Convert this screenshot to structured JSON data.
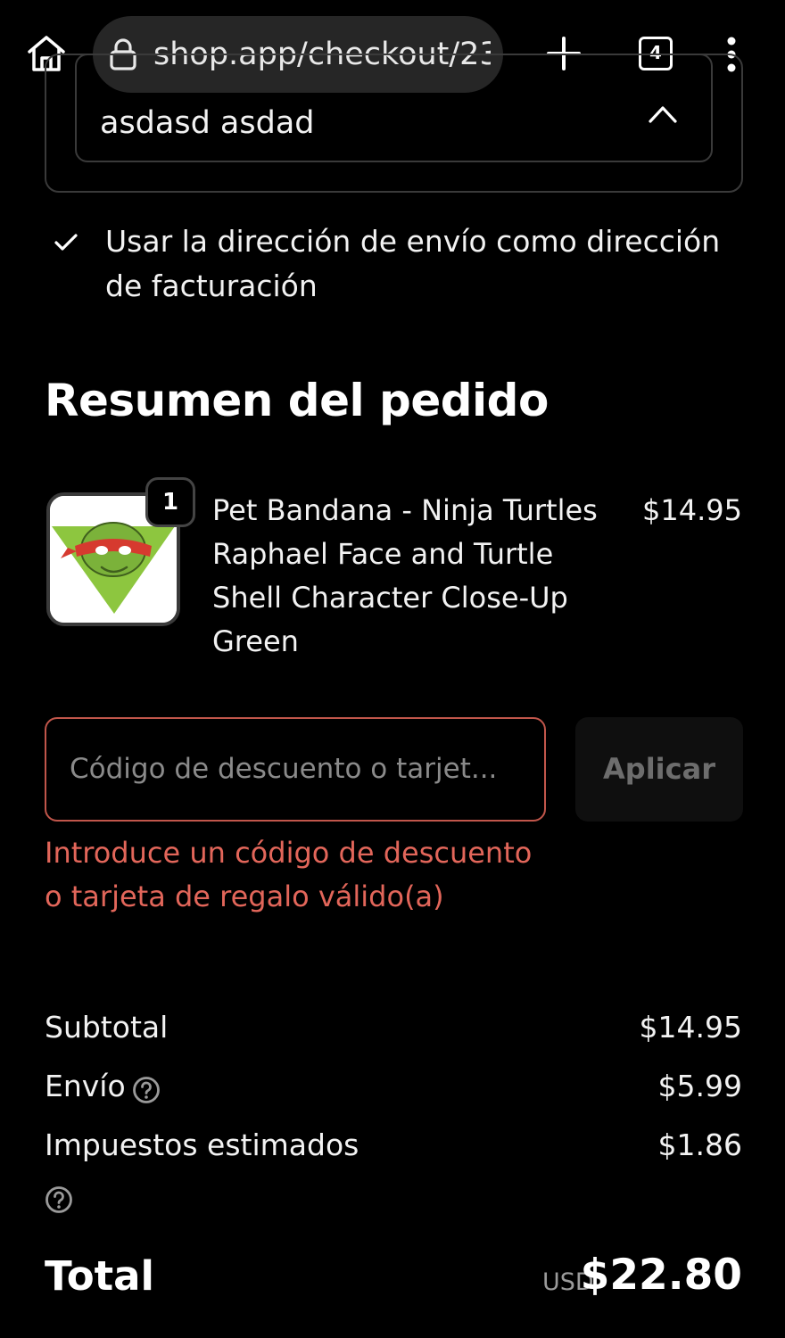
{
  "browser": {
    "url": "shop.app/checkout/23",
    "tab_count": "4"
  },
  "shipping": {
    "name_value": "asdasd asdad"
  },
  "billing": {
    "same_as_shipping_label": "Usar la dirección de envío como dirección de facturación"
  },
  "order_summary": {
    "title": "Resumen del pedido",
    "item": {
      "quantity": "1",
      "name": "Pet Bandana - Ninja Turtles Raphael Face and Turtle Shell Character Close-Up Green",
      "price": "$14.95"
    },
    "discount": {
      "placeholder": "Código de descuento o tarjet...",
      "apply_label": "Aplicar",
      "error": "Introduce un código de descuento o tarjeta de regalo válido(a)"
    },
    "subtotal": {
      "label": "Subtotal",
      "value": "$14.95"
    },
    "shipping_cost": {
      "label": "Envío",
      "value": "$5.99"
    },
    "taxes": {
      "label": "Impuestos estimados",
      "value": "$1.86"
    },
    "total": {
      "label": "Total",
      "currency": "USD",
      "value": "$22.80"
    }
  },
  "colors": {
    "background": "#000000",
    "error": "#e2665a",
    "bandana_green": "#8dc63f",
    "mask_red": "#d63a2f"
  }
}
